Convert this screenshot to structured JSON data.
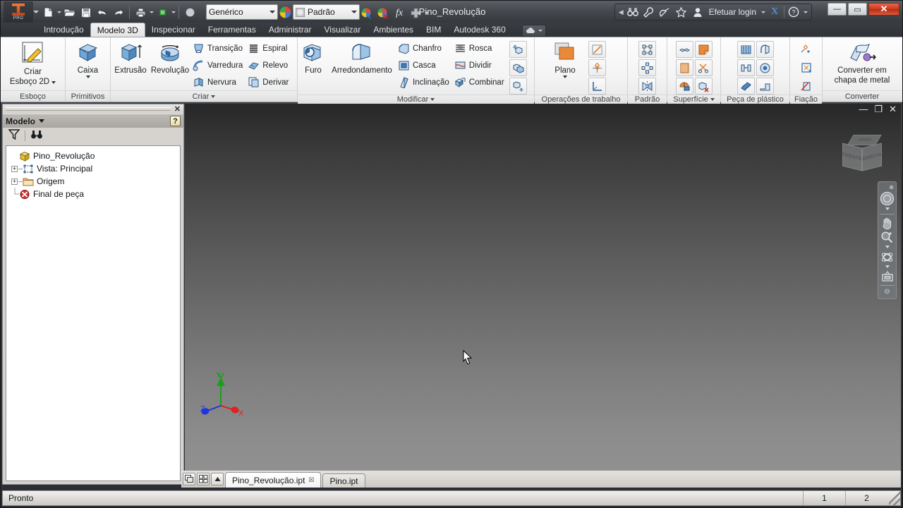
{
  "app": {
    "logo_text": "PRO",
    "document_title": "Pino_Revolução"
  },
  "quick_access": {
    "items": [
      {
        "name": "new-file-icon",
        "label": "Novo"
      },
      {
        "name": "open-file-icon",
        "label": "Abrir"
      },
      {
        "name": "save-icon",
        "label": "Salvar"
      },
      {
        "name": "undo-icon",
        "label": "Desfazer"
      },
      {
        "name": "redo-icon",
        "label": "Refazer"
      },
      {
        "name": "print-icon",
        "label": "Imprimir"
      },
      {
        "name": "return-icon",
        "label": "Retornar"
      },
      {
        "name": "appearance-sphere-icon",
        "label": "Aparência"
      }
    ],
    "material_value": "Genérico",
    "appearance_value": "Padrão",
    "fx_label": "fx"
  },
  "info_center": {
    "search_placeholder": "",
    "login_label": "Efetuar login",
    "exchange_label": "X",
    "help_label": "?"
  },
  "window_controls": {
    "minimize": "—",
    "restore": "▭",
    "close": "✕"
  },
  "ribbon": {
    "tabs": [
      {
        "label": "Introdução",
        "active": false
      },
      {
        "label": "Modelo 3D",
        "active": true
      },
      {
        "label": "Inspecionar",
        "active": false
      },
      {
        "label": "Ferramentas",
        "active": false
      },
      {
        "label": "Administrar",
        "active": false
      },
      {
        "label": "Visualizar",
        "active": false
      },
      {
        "label": "Ambientes",
        "active": false
      },
      {
        "label": "BIM",
        "active": false
      },
      {
        "label": "Autodesk 360",
        "active": false
      }
    ],
    "panels": [
      {
        "title": "Esboço",
        "has_caret": false,
        "big_buttons": [
          {
            "label": "Criar\nEsboço 2D",
            "label_line1": "Criar",
            "label_line2": "Esboço 2D",
            "icon": "sketch-2d-icon",
            "dropdown": true
          }
        ]
      },
      {
        "title": "Primitivos",
        "has_caret": false,
        "big_buttons": [
          {
            "label_line1": "Caixa",
            "label_line2": "",
            "icon": "box-primitive-icon",
            "dropdown": true
          }
        ]
      },
      {
        "title": "Criar",
        "has_caret": true,
        "big_buttons": [
          {
            "label_line1": "Extrusão",
            "label_line2": "",
            "icon": "extrude-icon",
            "dropdown": false
          },
          {
            "label_line1": "Revolução",
            "label_line2": "",
            "icon": "revolve-icon",
            "dropdown": false
          }
        ],
        "small_buttons": [
          {
            "label": "Transição",
            "icon": "loft-icon"
          },
          {
            "label": "Varredura",
            "icon": "sweep-icon"
          },
          {
            "label": "Nervura",
            "icon": "rib-icon"
          },
          {
            "label": "Espiral",
            "icon": "coil-icon"
          },
          {
            "label": "Relevo",
            "icon": "emboss-icon"
          },
          {
            "label": "Derivar",
            "icon": "derive-icon"
          }
        ]
      },
      {
        "title": "Modificar",
        "has_caret": true,
        "big_buttons": [
          {
            "label_line1": "Furo",
            "label_line2": "",
            "icon": "hole-icon",
            "dropdown": false
          },
          {
            "label_line1": "Arredondamento",
            "label_line2": "",
            "icon": "fillet-icon",
            "dropdown": false
          }
        ],
        "small_buttons": [
          {
            "label": "Chanfro",
            "icon": "chamfer-icon"
          },
          {
            "label": "Casca",
            "icon": "shell-icon"
          },
          {
            "label": "Inclinação",
            "icon": "draft-icon"
          },
          {
            "label": "Rosca",
            "icon": "thread-icon"
          },
          {
            "label": "Dividir",
            "icon": "split-icon"
          },
          {
            "label": "Combinar",
            "icon": "combine-icon"
          }
        ],
        "icon_buttons": [
          [
            "move-face-icon"
          ],
          [
            "copy-object-icon"
          ],
          [
            "move-body-icon"
          ]
        ]
      },
      {
        "title": "Operações de trabalho",
        "has_caret": false,
        "big_buttons": [
          {
            "label_line1": "Plano",
            "label_line2": "",
            "icon": "work-plane-icon",
            "dropdown": true
          }
        ],
        "icon_buttons": [
          [
            "work-axis-icon"
          ],
          [
            "work-point-icon"
          ],
          [
            "ucs-icon"
          ]
        ]
      },
      {
        "title": "Padrão",
        "has_caret": false,
        "icon_buttons": [
          [
            "rectangular-pattern-icon"
          ],
          [
            "circular-pattern-icon"
          ],
          [
            "mirror-icon"
          ]
        ]
      },
      {
        "title": "Superfície",
        "has_caret": true,
        "icon_buttons": [
          [
            "thicken-offset-icon",
            "patch-icon"
          ],
          [
            "ruled-surface-icon",
            "trim-surface-icon"
          ],
          [
            "stitch-icon",
            "delete-face-icon"
          ]
        ]
      },
      {
        "title": "Peça de plástico",
        "has_caret": false,
        "icon_buttons": [
          [
            "grill-icon",
            "rule-fillet-icon"
          ],
          [
            "rest-icon",
            "boss-icon"
          ],
          [
            "snap-fit-icon",
            "lip-icon"
          ]
        ]
      },
      {
        "title": "Fiação",
        "has_caret": false,
        "icon_buttons": [
          [
            "create-wire-icon"
          ],
          [
            "route-icon"
          ],
          [
            "harness-icon"
          ]
        ]
      },
      {
        "title": "Converter",
        "has_caret": false,
        "big_buttons": [
          {
            "label_line1": "Converter em",
            "label_line2": "chapa de metal",
            "icon": "convert-sheetmetal-icon",
            "dropdown": false
          }
        ]
      }
    ]
  },
  "browser": {
    "title": "Modelo",
    "help_label": "?",
    "close_label": "✕",
    "tools": [
      {
        "name": "filter-icon",
        "label": "Filtro"
      },
      {
        "name": "find-binoculars-icon",
        "label": "Localizar"
      }
    ],
    "tree": [
      {
        "label": "Pino_Revolução",
        "indent": 0,
        "expander": "",
        "icon": "part-icon"
      },
      {
        "label": "Vista: Principal",
        "indent": 1,
        "expander": "+",
        "icon": "view-icon"
      },
      {
        "label": "Origem",
        "indent": 1,
        "expander": "+",
        "icon": "folder-icon"
      },
      {
        "label": "Final de peça",
        "indent": 1,
        "expander": "",
        "icon": "end-of-part-icon"
      }
    ]
  },
  "viewport": {
    "window_controls": {
      "minimize": "—",
      "restore": "❐",
      "close": "✕"
    },
    "viewcube": {
      "top": "TOPO",
      "front": "FRENTE",
      "right": "DIREITA"
    },
    "navbar": {
      "close_label": "⊗",
      "items": [
        {
          "name": "steering-wheel-icon",
          "label": "Roda de navegação",
          "caret": true
        },
        {
          "name": "pan-hand-icon",
          "label": "Pan",
          "caret": false
        },
        {
          "name": "zoom-magnifier-icon",
          "label": "Zoom",
          "caret": true
        },
        {
          "name": "orbit-icon",
          "label": "Orbitar",
          "caret": true
        },
        {
          "name": "look-at-icon",
          "label": "Olhar para",
          "caret": false
        }
      ],
      "bottom_label": "⊖"
    },
    "axis_triad": {
      "x_label": "X",
      "y_label": "Y",
      "z_label": "Z",
      "x_color": "#e02222",
      "y_color": "#16a016",
      "z_color": "#2233dd"
    },
    "gradient_top": "#272727",
    "gradient_bottom": "#909090"
  },
  "doc_tabs": {
    "buttons": [
      {
        "name": "cascade-windows-icon",
        "label": "Cascata"
      },
      {
        "name": "tile-windows-icon",
        "label": "Lado a lado"
      },
      {
        "name": "scroll-up-icon",
        "label": "Rolar"
      }
    ],
    "tabs": [
      {
        "label": "Pino_Revolução.ipt",
        "active": true,
        "close": "☒"
      },
      {
        "label": "Pino.ipt",
        "active": false,
        "close": ""
      }
    ]
  },
  "status_bar": {
    "message": "Pronto",
    "cells": [
      "1",
      "2"
    ]
  }
}
